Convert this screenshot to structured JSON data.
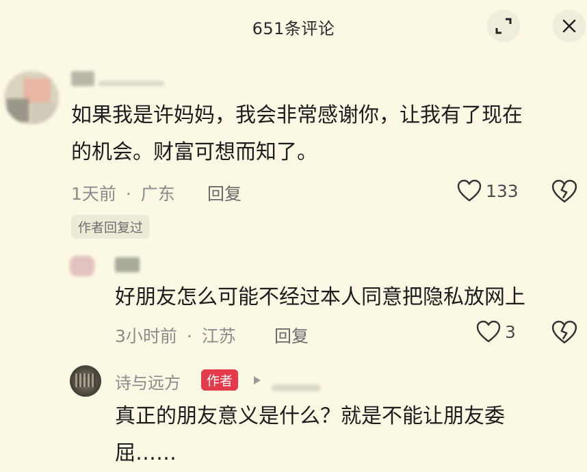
{
  "header": {
    "title": "651条评论"
  },
  "comments": [
    {
      "text_line1": "如果我是许妈妈，我会非常感谢你，让我有了现在",
      "text_line2": "的机会。财富可想而知了。",
      "time": "1天前",
      "dot": "·",
      "location": "广东",
      "reply_label": "回复",
      "likes": "133",
      "author_replied": "作者回复过"
    },
    {
      "text": "好朋友怎么可能不经过本人同意把隐私放网上",
      "time": "3小时前",
      "dot": "·",
      "location": "江苏",
      "reply_label": "回复",
      "likes": "3"
    },
    {
      "username": "诗与远方",
      "badge": "作者",
      "text_line1": "真正的朋友意义是什么？就是不能让朋友委",
      "text_line2": "屈……"
    }
  ],
  "icons": {
    "collapse": "collapse-icon",
    "close": "close-icon",
    "heart": "heart-icon",
    "dislike": "broken-heart-icon",
    "play": "play-icon"
  },
  "colors": {
    "background": "#fbf8e4",
    "badge": "#e53a49",
    "meta": "#8b8b8b"
  }
}
